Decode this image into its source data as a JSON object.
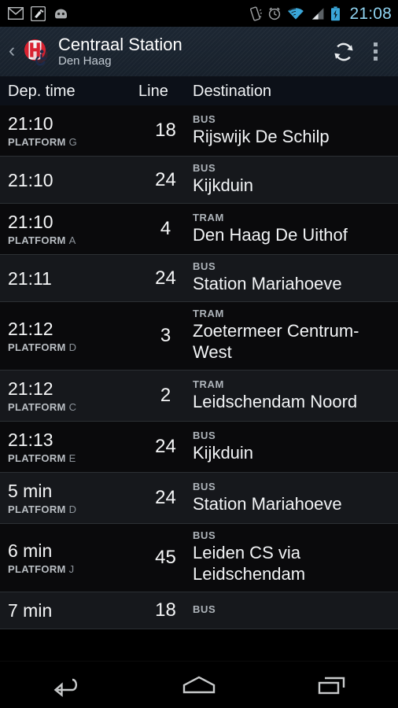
{
  "status_bar": {
    "time": "21:08",
    "left_icons": [
      "gmail-icon",
      "tool-icon",
      "android-head-icon"
    ],
    "right_icons": [
      "vibrate-icon",
      "alarm-icon",
      "wifi-icon",
      "signal-icon",
      "battery-charging-icon"
    ],
    "clock_color": "#8fd3f0"
  },
  "action_bar": {
    "up_label": "‹",
    "title": "Centraal Station",
    "subtitle": "Den Haag",
    "logo_name": "htm-accessibility-logo",
    "refresh_label": "refresh-icon",
    "overflow_label": "overflow-menu-icon",
    "bg_color": "#1d2733"
  },
  "table": {
    "headers": {
      "time": "Dep. time",
      "line": "Line",
      "destination": "Destination"
    },
    "platform_prefix": "PLATFORM",
    "rows": [
      {
        "time": "21:10",
        "platform": "G",
        "line": "18",
        "mode": "BUS",
        "destination": "Rijswijk De Schilp"
      },
      {
        "time": "21:10",
        "platform": "",
        "line": "24",
        "mode": "BUS",
        "destination": "Kijkduin"
      },
      {
        "time": "21:10",
        "platform": "A",
        "line": "4",
        "mode": "TRAM",
        "destination": "Den Haag De Uithof"
      },
      {
        "time": "21:11",
        "platform": "",
        "line": "24",
        "mode": "BUS",
        "destination": "Station Mariahoeve"
      },
      {
        "time": "21:12",
        "platform": "D",
        "line": "3",
        "mode": "TRAM",
        "destination": "Zoetermeer Centrum-West"
      },
      {
        "time": "21:12",
        "platform": "C",
        "line": "2",
        "mode": "TRAM",
        "destination": "Leidschendam Noord"
      },
      {
        "time": "21:13",
        "platform": "E",
        "line": "24",
        "mode": "BUS",
        "destination": "Kijkduin"
      },
      {
        "time": "5 min",
        "platform": "D",
        "line": "24",
        "mode": "BUS",
        "destination": "Station Mariahoeve"
      },
      {
        "time": "6 min",
        "platform": "J",
        "line": "45",
        "mode": "BUS",
        "destination": "Leiden CS via Leidschendam"
      },
      {
        "time": "7 min",
        "platform": "",
        "line": "18",
        "mode": "BUS",
        "destination": ""
      }
    ]
  },
  "nav_bar": {
    "back_label": "back-icon",
    "home_label": "home-icon",
    "recents_label": "recents-icon"
  }
}
